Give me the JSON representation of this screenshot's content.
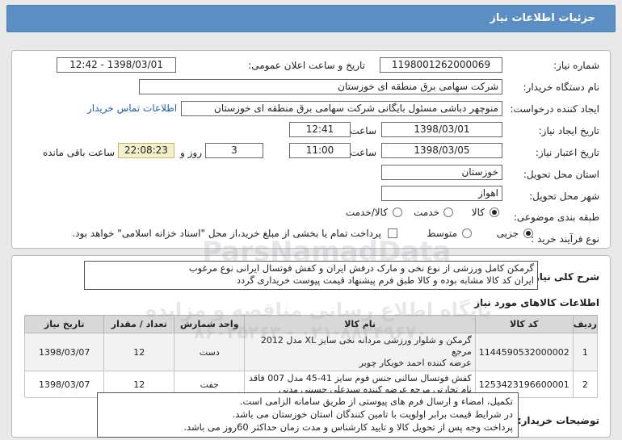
{
  "header": {
    "title": "جزئیات اطلاعات نیاز"
  },
  "form": {
    "need_number_label": "شماره نیاز:",
    "need_number": "1198001262000069",
    "announce_label": "تاریخ و ساعت اعلان عمومی:",
    "announce_value": "1398/03/01 - 12:42",
    "buyer_org_label": "نام دستگاه خریدار:",
    "buyer_org": "شرکت سهامی برق منطقه ای خوزستان",
    "creator_label": "ایجاد کننده درخواست:",
    "creator": "منوچهر دباشی مسئول بایگانی شرکت سهامی برق منطقه ای خوزستان",
    "contact_link": "اطلاعات تماس خریدار",
    "created_date_label": "تاریخ ایجاد نیاز:",
    "created_date": "1398/03/01",
    "time_label": "ساعت",
    "created_time": "12:41",
    "valid_date_label": "تاریخ اعتبار نیاز:",
    "valid_date": "1398/03/05",
    "valid_time": "11:00",
    "days_value": "3",
    "days_label": "روز و",
    "remaining_time": "22:08:23",
    "remaining_label": "ساعت باقی مانده",
    "province_label": "استان محل تحویل:",
    "province": "خوزستان",
    "city_label": "شهر محل تحویل:",
    "city": "اهواز",
    "category_label": "طبقه بندی موضوعی:",
    "category_options": [
      "کالا",
      "خدمت",
      "کالا/خدمت"
    ],
    "process_label": "نوع فرآیند خرید :",
    "process_options": [
      "جزیی",
      "متوسط"
    ],
    "payment_note": "پرداخت تمام یا بخشی از مبلغ خرید،از محل \"اسناد خزانه اسلامی\" خواهد بود."
  },
  "summary": {
    "label": "شرح کلی نیاز:",
    "line1": "گرمکن کامل ورزشی از نوع نخی و مارک درفش ایران و کفش فوتسال ایرانی نوع مرغوب",
    "line2": "ایران کد کالا مشابه بوده و کالا طبق فرم پیشنهاد قیمت پیوست خریداری گردد"
  },
  "goods": {
    "title": "اطلاعات کالاهای مورد نیاز",
    "columns": [
      "ردیف",
      "کد کالا",
      "نام کالا",
      "واحد شمارش",
      "تعداد / مقدار",
      "تاریخ نیاز"
    ],
    "rows": [
      {
        "idx": "1",
        "code": "1144590532000002",
        "name_l1": "گرمکن و شلوار ورزشی مردانه نخی سایز XL مدل 2012 مرجع",
        "name_l2": "عرضه کننده احمد خوبکار چوبر",
        "unit": "دست",
        "qty": "12",
        "date": "1398/03/07"
      },
      {
        "idx": "2",
        "code": "1253423196600001",
        "name_l1": "کفش فوتسال سالنی جنس فوم سایز 41-45 مدل 007 فاقد",
        "name_l2": "نام تجارتی مرجع عرضه کننده سیدعلی حسینی مدنی",
        "unit": "جفت",
        "qty": "12",
        "date": "1398/03/07"
      }
    ]
  },
  "buyer_notes": {
    "label": "توضیحات خریدار:",
    "line1": "تکمیل، امضاء و ارسال فرم های پیوستی از طریق سامانه الزامی است.",
    "line2": "در شرایط  قیمت برابر اولویت با تامین کنندگان استان خوزستان می باشد.",
    "line3": "پرداخت وجه پس از تحویل کالا و تایید کارشناس و مدت زمان حداکثر 60روز می باشد."
  },
  "watermark": {
    "latin": "ParsNamadData",
    "persian": "پایگاه اطلاع رسانی مناقصه و مزایده",
    "phone": "۰۲۱-۸۸۳۴۹۶۷۰ - ۸۶۰۲۵۲۶۳"
  }
}
